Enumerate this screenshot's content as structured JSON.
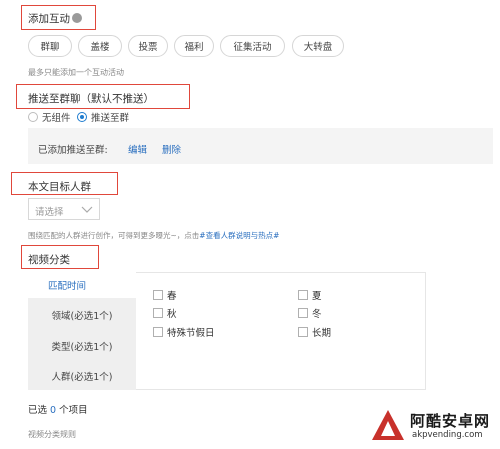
{
  "interaction": {
    "title": "添加互动",
    "buttons": [
      "群聊",
      "盖楼",
      "投票",
      "福利",
      "征集活动",
      "大转盘"
    ],
    "hint": "最多只能添加一个互动活动"
  },
  "push": {
    "title": "推送至群聊（默认不推送）",
    "options": [
      "无组件",
      "推送至群"
    ],
    "selected": "推送至群",
    "added_label": "已添加推送至群:",
    "edit": "编辑",
    "delete": "删除"
  },
  "audience": {
    "title": "本文目标人群",
    "select_placeholder": "请选择",
    "hint_prefix": "围绕匹配的人群进行创作，可得到更多曝光~，点击",
    "hint_link": "#查看人群说明与热点#"
  },
  "video": {
    "title": "视频分类",
    "tabs": [
      "匹配时间",
      "领域(必选1个)",
      "类型(必选1个)",
      "人群(必选1个)"
    ],
    "active_tab": "匹配时间",
    "options_left": [
      "春",
      "秋",
      "特殊节假日"
    ],
    "options_right": [
      "夏",
      "冬",
      "长期"
    ],
    "selected_prefix": "已选",
    "selected_count": "0",
    "selected_suffix": "个项目",
    "rules": "视频分类规则"
  },
  "watermark": {
    "brand": "阿酷安卓网",
    "url": "akpvending.com"
  },
  "colors": {
    "accent": "#2a6fbf",
    "annotation": "#e0473b",
    "watermark": "#c8312b"
  }
}
